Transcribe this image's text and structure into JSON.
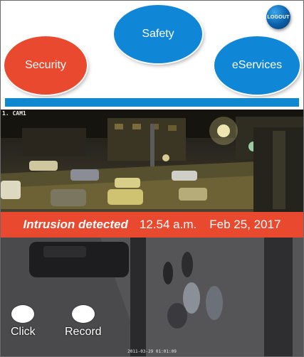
{
  "header": {
    "nav": {
      "security_label": "Security",
      "safety_label": "Safety",
      "eservices_label": "eServices"
    },
    "logout_label": "LOGOUT"
  },
  "camera": {
    "camera_label": "1. CAM1",
    "timestamp": "2011-03-29 01:01:09",
    "alert": {
      "title": "Intrusion detected",
      "time": "12.54 a.m.",
      "date": "Feb 25, 2017"
    },
    "controls": {
      "click_label": "Click",
      "record_label": "Record"
    }
  },
  "colors": {
    "security_red": "#e94a2f",
    "brand_blue": "#0f86d6"
  }
}
